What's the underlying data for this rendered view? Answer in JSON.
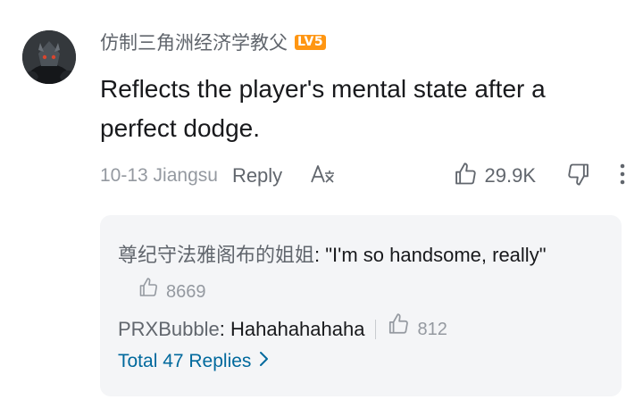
{
  "comment": {
    "username": "仿制三角洲经济学教父",
    "level": "LV5",
    "text": "Reflects the player's mental state after a perfect dodge.",
    "time_location": "10-13 Jiangsu",
    "reply_label": "Reply",
    "translate_label": "A文",
    "like_count": "29.9K"
  },
  "replies": {
    "items": [
      {
        "author": "尊纪守法雅阁布的姐姐",
        "text": "\"I'm so handsome, really\"",
        "likes": "8669"
      },
      {
        "author": "PRXBubble",
        "text": "Hahahahahaha",
        "likes": "812"
      }
    ],
    "total_label": "Total 47 Replies"
  },
  "colors": {
    "level_badge": "#ff9612",
    "link_blue": "#00699d",
    "panel_bg": "#f4f5f7",
    "secondary_text": "#61666d",
    "muted_text": "#9499a0"
  }
}
